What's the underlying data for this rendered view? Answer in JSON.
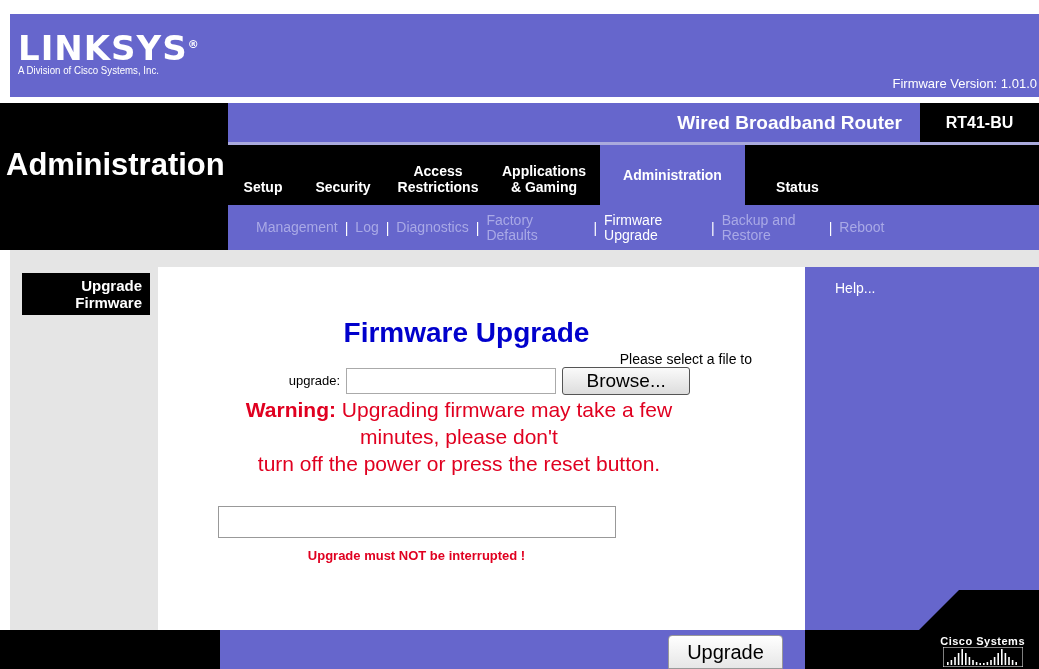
{
  "header": {
    "logo": "LINKSYS",
    "logo_mark": "®",
    "tagline": "A Division of Cisco Systems, Inc.",
    "firmware_version": "Firmware Version: 1.01.0"
  },
  "section_title": "Administration",
  "product": {
    "name": "Wired Broadband Router",
    "model": "RT41-BU"
  },
  "tabs": [
    {
      "label": "Setup",
      "selected": false
    },
    {
      "label": "Security",
      "selected": false
    },
    {
      "label": "Access Restrictions",
      "selected": false
    },
    {
      "label": "Applications & Gaming",
      "selected": false
    },
    {
      "label": "Administration",
      "selected": true
    },
    {
      "label": "Status",
      "selected": false
    }
  ],
  "subtabs": [
    {
      "kind": "link",
      "label": "Management",
      "selected": false
    },
    {
      "kind": "separator",
      "label": "|"
    },
    {
      "kind": "link",
      "label": "Log",
      "selected": false
    },
    {
      "kind": "separator",
      "label": "|"
    },
    {
      "kind": "link",
      "label": "Diagnostics",
      "selected": false
    },
    {
      "kind": "separator",
      "label": "|"
    },
    {
      "kind": "link",
      "label": "Factory Defaults",
      "selected": false
    },
    {
      "kind": "separator",
      "label": "|"
    },
    {
      "kind": "link",
      "label": "Firmware Upgrade",
      "selected": true
    },
    {
      "kind": "separator",
      "label": "|"
    },
    {
      "kind": "link",
      "label": "Backup and Restore",
      "selected": false
    },
    {
      "kind": "separator",
      "label": "|"
    },
    {
      "kind": "link",
      "label": "Reboot",
      "selected": false
    }
  ],
  "sidebar_label": "Upgrade Firmware",
  "form": {
    "title": "Firmware Upgrade",
    "prompt": "Please select a file to",
    "field_label": "upgrade:",
    "browse_button": "Browse...",
    "warning_lines": [
      "**Warning:** Upgrading firmware may take a few",
      "minutes, please don't",
      "turn off the power or press the reset button."
    ],
    "progress": {
      "level": 0
    },
    "notice": "Upgrade must NOT be interrupted !"
  },
  "help": "Help...",
  "upgrade_button": "Upgrade",
  "footer_logo": "Cisco Systems"
}
